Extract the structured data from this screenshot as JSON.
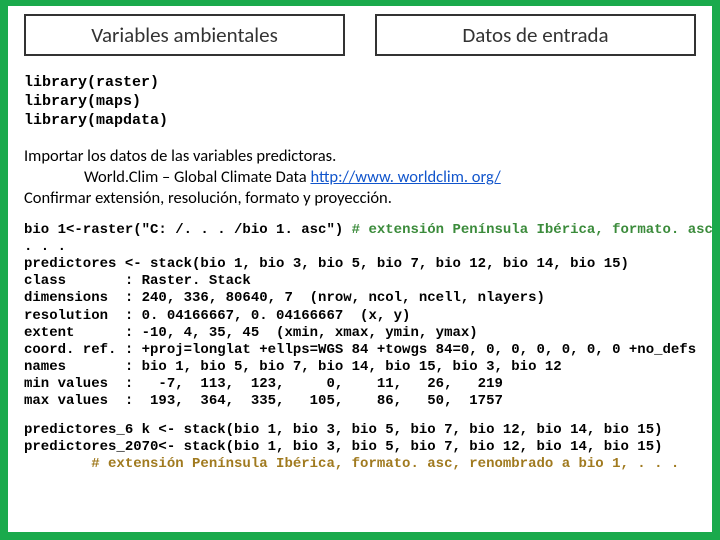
{
  "header": {
    "left_title": "Variables ambientales",
    "right_title": "Datos de entrada"
  },
  "libs": {
    "l1": "library(raster)",
    "l2": "library(maps)",
    "l3": "library(mapdata)"
  },
  "intro": {
    "p1": "Importar los datos de las variables predictoras.",
    "p2a": "World.Clim – Global Climate Data ",
    "p2link": "http://www. worldclim. org/",
    "p3": "Confirmar extensión, resolución, formato y proyección."
  },
  "code": {
    "line1a": "bio 1<-raster(\"C: /. . . /bio 1. asc\")",
    "line1c": " # extensión Península Ibérica, formato. asc",
    "dots": ". . .",
    "line2": "predictores <- stack(bio 1, bio 3, bio 5, bio 7, bio 12, bio 14, bio 15)",
    "line3": "class       : Raster. Stack",
    "line4": "dimensions  : 240, 336, 80640, 7  (nrow, ncol, ncell, nlayers)",
    "line5": "resolution  : 0. 04166667, 0. 04166667  (x, y)",
    "line6": "extent      : -10, 4, 35, 45  (xmin, xmax, ymin, ymax)",
    "line7": "coord. ref. : +proj=longlat +ellps=WGS 84 +towgs 84=0, 0, 0, 0, 0, 0, 0 +no_defs",
    "line8": "names       : bio 1, bio 5, bio 7, bio 14, bio 15, bio 3, bio 12",
    "line9": "min values  :   -7,  113,  123,     0,    11,   26,   219",
    "line10": "max values  :  193,  364,  335,   105,    86,   50,  1757"
  },
  "code3": {
    "l1": "predictores_6 k <- stack(bio 1, bio 3, bio 5, bio 7, bio 12, bio 14, bio 15)",
    "l2": "predictores_2070<- stack(bio 1, bio 3, bio 5, bio 7, bio 12, bio 14, bio 15)",
    "l3": "        # extensión Península Ibérica, formato. asc, renombrado a bio 1, . . ."
  }
}
